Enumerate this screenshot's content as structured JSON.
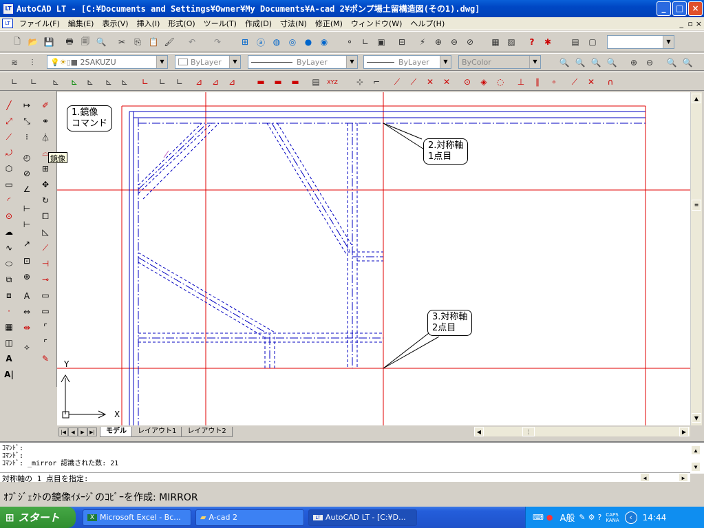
{
  "window": {
    "title": "AutoCAD LT - [C:¥Documents and Settings¥Owner¥My Documents¥A-cad 2¥ポンプ場土留構造図(その1).dwg]"
  },
  "menu": [
    "ファイル(F)",
    "編集(E)",
    "表示(V)",
    "挿入(I)",
    "形式(O)",
    "ツール(T)",
    "作成(D)",
    "寸法(N)",
    "修正(M)",
    "ウィンドウ(W)",
    "ヘルプ(H)"
  ],
  "toolbar": {
    "layer": "2SAKUZU",
    "color": "ByLayer",
    "linetype": "ByLayer",
    "lineweight": "ByLayer",
    "plotstyle": "ByColor"
  },
  "tooltip": "鏡像",
  "callouts": {
    "c1": "1.鏡像\nコマンド",
    "c2": "2.対称軸\n1点目",
    "c3": "3.対称軸\n2点目"
  },
  "ucs": {
    "x": "X",
    "y": "Y"
  },
  "tabs": [
    "モデル",
    "レイアウト1",
    "レイアウト2"
  ],
  "command": {
    "lines": [
      "ｺﾏﾝﾄﾞ:",
      "ｺﾏﾝﾄﾞ:",
      "ｺﾏﾝﾄﾞ: _mirror 認識された数: 21"
    ],
    "prompt": "対称軸の 1 点目を指定:"
  },
  "status": "ｵﾌﾞｼﾞｪｸﾄの鏡像ｲﾒｰｼﾞのｺﾋﾟｰを作成:  MIRROR",
  "taskbar": {
    "start": "スタート",
    "tasks": [
      "Microsoft Excel - Bc...",
      "A-cad 2",
      "AutoCAD LT - [C:¥D..."
    ],
    "time": "14:44",
    "ime": "A般",
    "caps": "CAPS",
    "kana": "KANA"
  },
  "colors": {
    "titlebar": "#0a5fd8",
    "redline": "#e00000",
    "blueline": "#0000c0"
  }
}
